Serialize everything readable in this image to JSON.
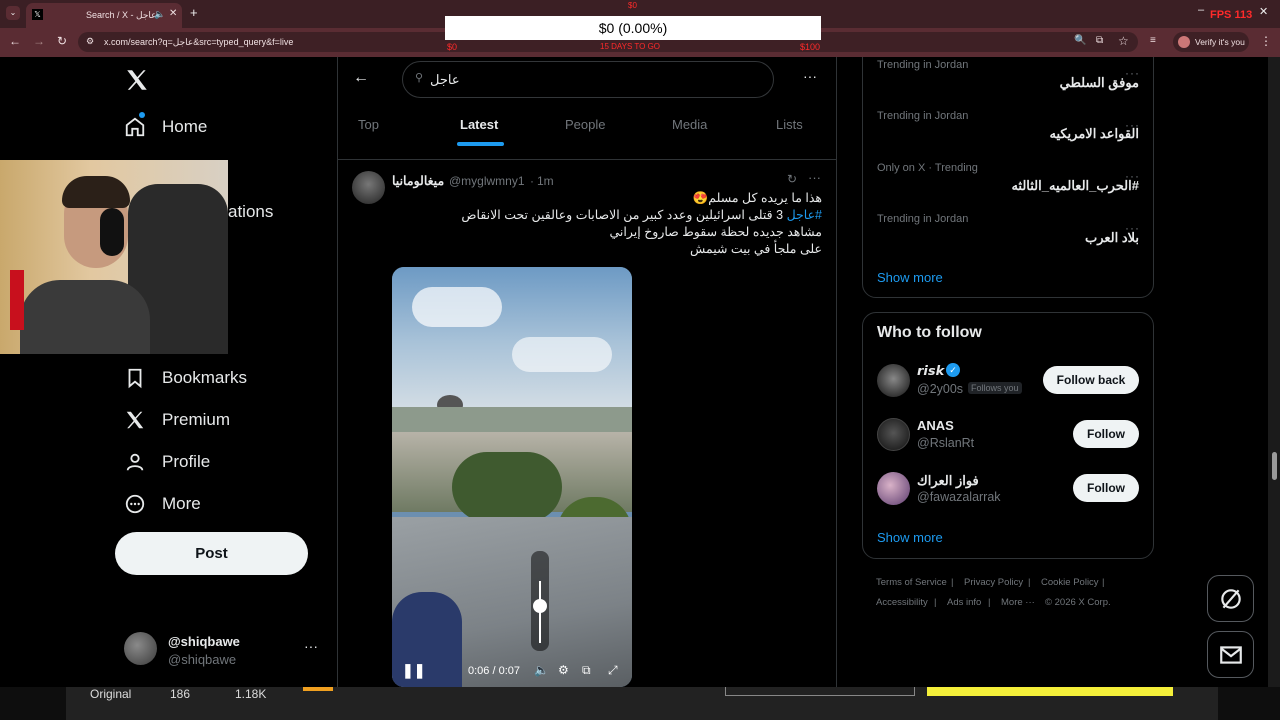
{
  "browser": {
    "tab_title": "Search / X - عاجل",
    "url": "x.com/search?q=عاجل&src=typed_query&f=live",
    "verify_label": "Verify it's you",
    "fps_label": "FPS 113"
  },
  "stream_overlay": {
    "money_text": "$0 (0.00%)",
    "left_amount": "$0",
    "mid_label": "15 DAYS TO GO",
    "right_amount": "$100",
    "top_marker": "$0"
  },
  "sidebar": {
    "home": "Home",
    "notifications_partial": "ations",
    "bookmarks": "Bookmarks",
    "premium": "Premium",
    "profile": "Profile",
    "more": "More",
    "post": "Post",
    "account_name": "@shiqbawe",
    "account_handle": "@shiqbawe"
  },
  "search": {
    "query": "عاجل",
    "tabs": [
      "Top",
      "Latest",
      "People",
      "Media",
      "Lists"
    ]
  },
  "tweet": {
    "author": "ميغالومانيا",
    "handle": "@myglwmny1",
    "time": "1m",
    "line1": "هذا ما يريده كل مسلم😍",
    "hashtag": "#عاجل",
    "line2": "3 قتلى اسرائيلين وعدد كبير من الاصابات وعالقين تحت الانقاض",
    "line3": "مشاهد جديده لحظة سقوط صاروخ إيراني",
    "line4": "على ملجأ في بيت شيمش",
    "video_time": "0:06 / 0:07"
  },
  "trends": [
    {
      "sub": "Trending in Jordan",
      "name": "موفق السلطي"
    },
    {
      "sub": "Trending in Jordan",
      "name": "القواعد الامريكيه"
    },
    {
      "sub": "Only on X · Trending",
      "name": "#الحرب_العالميه_الثالثه"
    },
    {
      "sub": "Trending in Jordan",
      "name": "بلاد العرب"
    }
  ],
  "trends_show_more": "Show more",
  "who_to_follow": {
    "title": "Who to follow",
    "users": [
      {
        "name": "𝙧𝙞𝙨𝙠",
        "handle": "@2y00s",
        "follows_you": "Follows you",
        "button": "Follow back"
      },
      {
        "name": "ANAS",
        "handle": "@RslanRt",
        "button": "Follow"
      },
      {
        "name": "فواز العراك",
        "handle": "@fawazalarrak",
        "button": "Follow"
      }
    ],
    "show_more": "Show more"
  },
  "footer": {
    "terms": "Terms of Service",
    "privacy": "Privacy Policy",
    "cookie": "Cookie Policy",
    "accessibility": "Accessibility",
    "ads": "Ads info",
    "more": "More ···",
    "copyright": "© 2026 X Corp."
  },
  "bottom_bar": {
    "original": "Original",
    "count1": "186",
    "count2": "1.18K"
  },
  "colors": {
    "accent": "#1d9bf0",
    "chrome": "#5a2c33",
    "background": "#000000"
  }
}
